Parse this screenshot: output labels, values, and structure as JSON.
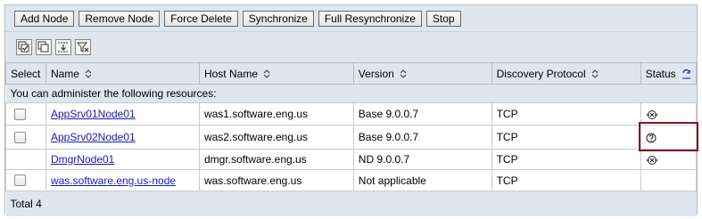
{
  "toolbar": {
    "buttons": [
      "Add Node",
      "Remove Node",
      "Force Delete",
      "Synchronize",
      "Full Resynchronize",
      "Stop"
    ]
  },
  "icon_toolbar": {
    "icons": [
      "select-all-icon",
      "deselect-all-icon",
      "show-filter-icon",
      "clear-filter-icon"
    ]
  },
  "table": {
    "headers": {
      "select": "Select",
      "name": "Name",
      "host": "Host Name",
      "version": "Version",
      "protocol": "Discovery Protocol",
      "status": "Status"
    },
    "info": "You can administer the following resources:",
    "rows": [
      {
        "name": "AppSrv01Node01",
        "host": "was1.software.eng.us",
        "version": "Base 9.0.0.7",
        "protocol": "TCP",
        "status_icon": "synchronized-icon",
        "has_checkbox": true
      },
      {
        "name": "AppSrv02Node01",
        "host": "was2.software.eng.us",
        "version": "Base 9.0.0.7",
        "protocol": "TCP",
        "status_icon": "unknown-status-icon",
        "has_checkbox": true
      },
      {
        "name": "DmgrNode01",
        "host": "dmgr.software.eng.us",
        "version": "ND 9.0.0.7",
        "protocol": "TCP",
        "status_icon": "synchronized-icon",
        "has_checkbox": false
      },
      {
        "name": "was.software.eng.us-node",
        "host": "was.software.eng.us",
        "version": "Not applicable",
        "protocol": "TCP",
        "status_icon": "",
        "has_checkbox": true
      }
    ],
    "total": "Total 4"
  },
  "colors": {
    "panel": "#dfe6ee",
    "link": "#1a1ab8",
    "highlight": "#7a1822"
  }
}
